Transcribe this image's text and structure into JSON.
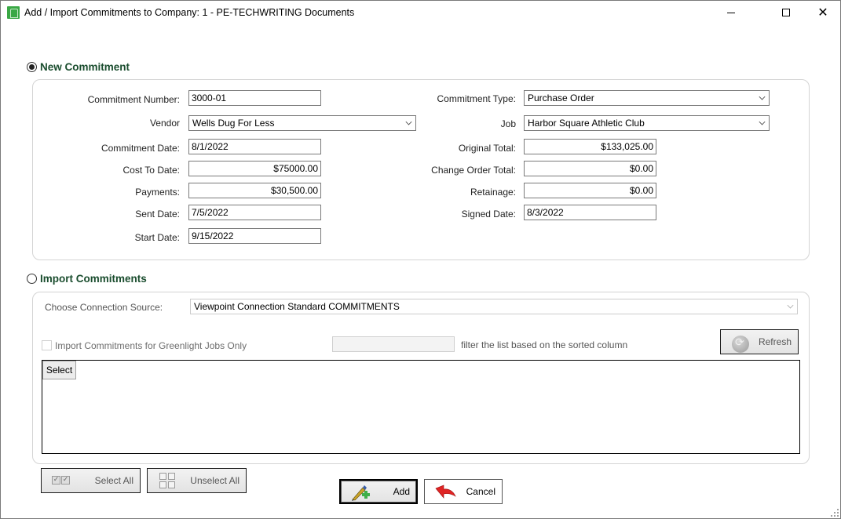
{
  "window": {
    "title": "Add / Import Commitments to Company: 1 - PE-TECHWRITING Documents",
    "controls": {
      "minimize": "minimize",
      "maximize": "maximize",
      "close": "✕"
    }
  },
  "new_commitment": {
    "title": "New Commitment",
    "selected": true,
    "fields": {
      "commitment_number": {
        "label": "Commitment Number:",
        "value": "3000-01"
      },
      "vendor": {
        "label": "Vendor",
        "value": "Wells Dug For Less"
      },
      "commitment_date": {
        "label": "Commitment Date:",
        "value": "8/1/2022"
      },
      "cost_to_date": {
        "label": "Cost To Date:",
        "value": "$75000.00"
      },
      "payments": {
        "label": "Payments:",
        "value": "$30,500.00"
      },
      "sent_date": {
        "label": "Sent Date:",
        "value": "7/5/2022"
      },
      "start_date": {
        "label": "Start Date:",
        "value": "9/15/2022"
      },
      "commitment_type": {
        "label": "Commitment Type:",
        "value": "Purchase Order"
      },
      "job": {
        "label": "Job",
        "value": "Harbor Square Athletic Club"
      },
      "original_total": {
        "label": "Original Total:",
        "value": "$133,025.00"
      },
      "change_order_total": {
        "label": "Change Order Total:",
        "value": "$0.00"
      },
      "retainage": {
        "label": "Retainage:",
        "value": "$0.00"
      },
      "signed_date": {
        "label": "Signed Date:",
        "value": "8/3/2022"
      }
    }
  },
  "import_commitments": {
    "title": "Import Commitments",
    "selected": false,
    "connection_source": {
      "label": "Choose Connection Source:",
      "value": "Viewpoint Connection Standard COMMITMENTS"
    },
    "greenlight_only": {
      "label": "Import Commitments for Greenlight Jobs Only",
      "checked": false
    },
    "filter": {
      "value": "",
      "hint": "filter the list based on the sorted column"
    },
    "refresh_label": "Refresh",
    "grid": {
      "select_column_label": "Select",
      "rows": []
    }
  },
  "footer": {
    "select_all_label": "Select All",
    "unselect_all_label": "Unselect All",
    "add_label": "Add",
    "cancel_label": "Cancel"
  }
}
